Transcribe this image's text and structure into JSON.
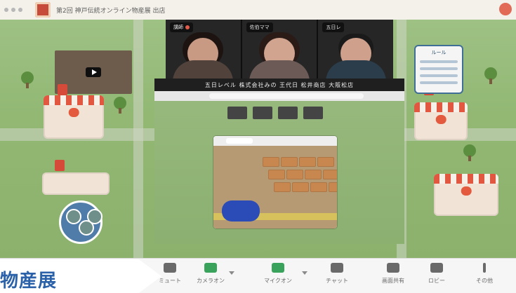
{
  "app": {
    "title": "第2回 神戸伝統オンライン物産展 出店"
  },
  "banner": {
    "text": "物産展"
  },
  "participants": [
    {
      "name": "講師"
    },
    {
      "name": "佐伯ママ"
    },
    {
      "name": "五日レ"
    }
  ],
  "shared_screen": {
    "toolbar_text": "五日レベル 株式会社みの 王代日 松井商店 大阪松店"
  },
  "info_card": {
    "title": "ルール"
  },
  "zoom_bar": {
    "items": [
      {
        "label": "ミュート",
        "icon": "mic-icon"
      },
      {
        "label": "カメラオン",
        "icon": "camera-icon"
      },
      {
        "label": "マイクオン",
        "icon": "mic-icon"
      },
      {
        "label": "チャット",
        "icon": "chat-icon"
      },
      {
        "label": "画面共有",
        "icon": "screen-share-icon"
      },
      {
        "label": "ロビー",
        "icon": "people-icon"
      },
      {
        "label": "その他",
        "icon": "more-icon"
      }
    ]
  },
  "colors": {
    "banner_text": "#2b61a8",
    "map_green": "#8fb673",
    "accent_red": "#e35a3e"
  }
}
